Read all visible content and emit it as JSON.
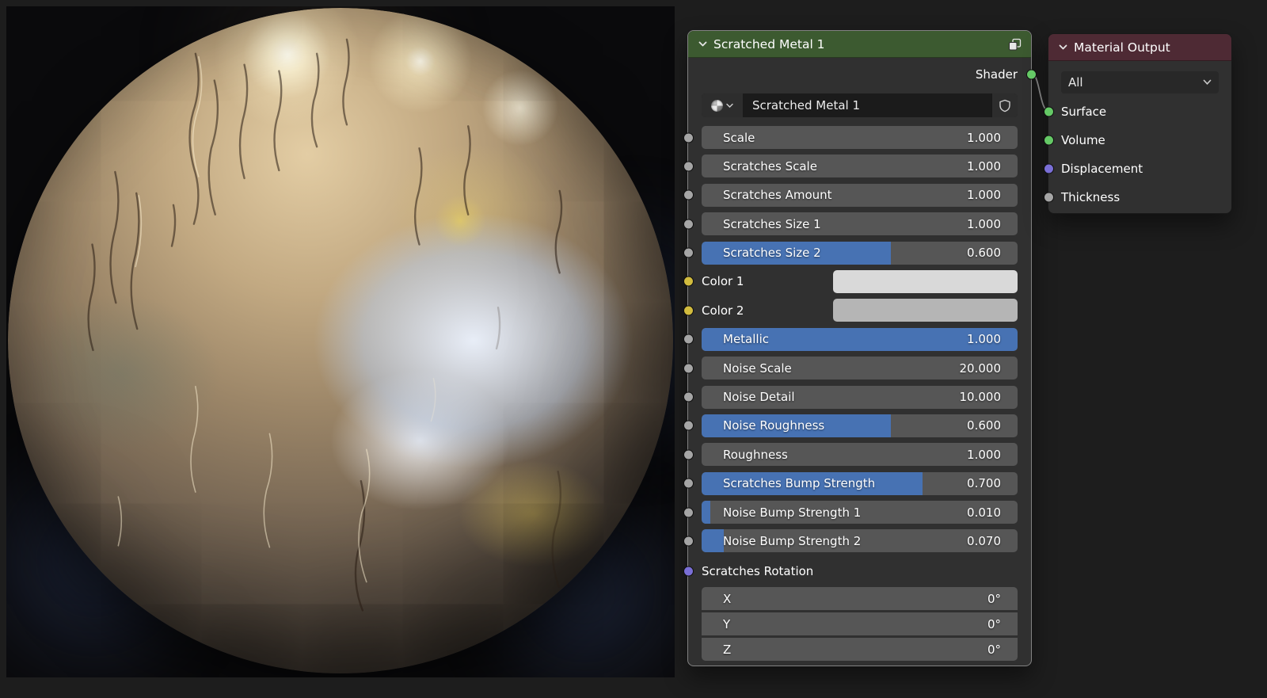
{
  "colors": {
    "editor_bg": "#1d1d1d",
    "node_body": "#303030",
    "group_header": "#3c5a30",
    "output_header": "#4e2a34",
    "accent_fill": "#4772b3",
    "widget_bg": "#565656",
    "socket_shader": "#65c966",
    "socket_float": "#a5a5a5",
    "socket_color": "#d2bc3e",
    "socket_vector": "#7a6fd6",
    "wire": "#9a9a9a"
  },
  "group_node": {
    "title": "Scratched Metal 1",
    "output_label": "Shader",
    "name_field": "Scratched Metal 1",
    "params": [
      {
        "type": "value",
        "label": "Scale",
        "value": "1.000",
        "fill": 0,
        "socket": "float"
      },
      {
        "type": "value",
        "label": "Scratches Scale",
        "value": "1.000",
        "fill": 0,
        "socket": "float"
      },
      {
        "type": "value",
        "label": "Scratches Amount",
        "value": "1.000",
        "fill": 0,
        "socket": "float"
      },
      {
        "type": "value",
        "label": "Scratches Size 1",
        "value": "1.000",
        "fill": 0,
        "socket": "float"
      },
      {
        "type": "slider",
        "label": "Scratches Size 2",
        "value": "0.600",
        "fill": 0.6,
        "socket": "float"
      },
      {
        "type": "color",
        "label": "Color 1",
        "swatch": "#d9d9d9",
        "socket": "color"
      },
      {
        "type": "color",
        "label": "Color 2",
        "swatch": "#b5b5b5",
        "socket": "color"
      },
      {
        "type": "slider",
        "label": "Metallic",
        "value": "1.000",
        "fill": 1,
        "socket": "float"
      },
      {
        "type": "value",
        "label": "Noise Scale",
        "value": "20.000",
        "fill": 0,
        "socket": "float"
      },
      {
        "type": "value",
        "label": "Noise Detail",
        "value": "10.000",
        "fill": 0,
        "socket": "float"
      },
      {
        "type": "slider",
        "label": "Noise Roughness",
        "value": "0.600",
        "fill": 0.6,
        "socket": "float"
      },
      {
        "type": "value",
        "label": "Roughness",
        "value": "1.000",
        "fill": 0,
        "socket": "float"
      },
      {
        "type": "slider",
        "label": "Scratches Bump Strength",
        "value": "0.700",
        "fill": 0.7,
        "socket": "float"
      },
      {
        "type": "slider",
        "label": "Noise Bump Strength 1",
        "value": "0.010",
        "fill": 0.027,
        "socket": "float"
      },
      {
        "type": "slider",
        "label": "Noise Bump Strength 2",
        "value": "0.070",
        "fill": 0.07,
        "socket": "float"
      }
    ],
    "vector_label": "Scratches Rotation",
    "axes": [
      {
        "label": "X",
        "value": "0°"
      },
      {
        "label": "Y",
        "value": "0°"
      },
      {
        "label": "Z",
        "value": "0°"
      }
    ]
  },
  "output_node": {
    "title": "Material Output",
    "dropdown_value": "All",
    "inputs": [
      {
        "label": "Surface",
        "socket_color": "#65c966"
      },
      {
        "label": "Volume",
        "socket_color": "#65c966"
      },
      {
        "label": "Displacement",
        "socket_color": "#7a6fd6"
      },
      {
        "label": "Thickness",
        "socket_color": "#a5a5a5"
      }
    ]
  }
}
